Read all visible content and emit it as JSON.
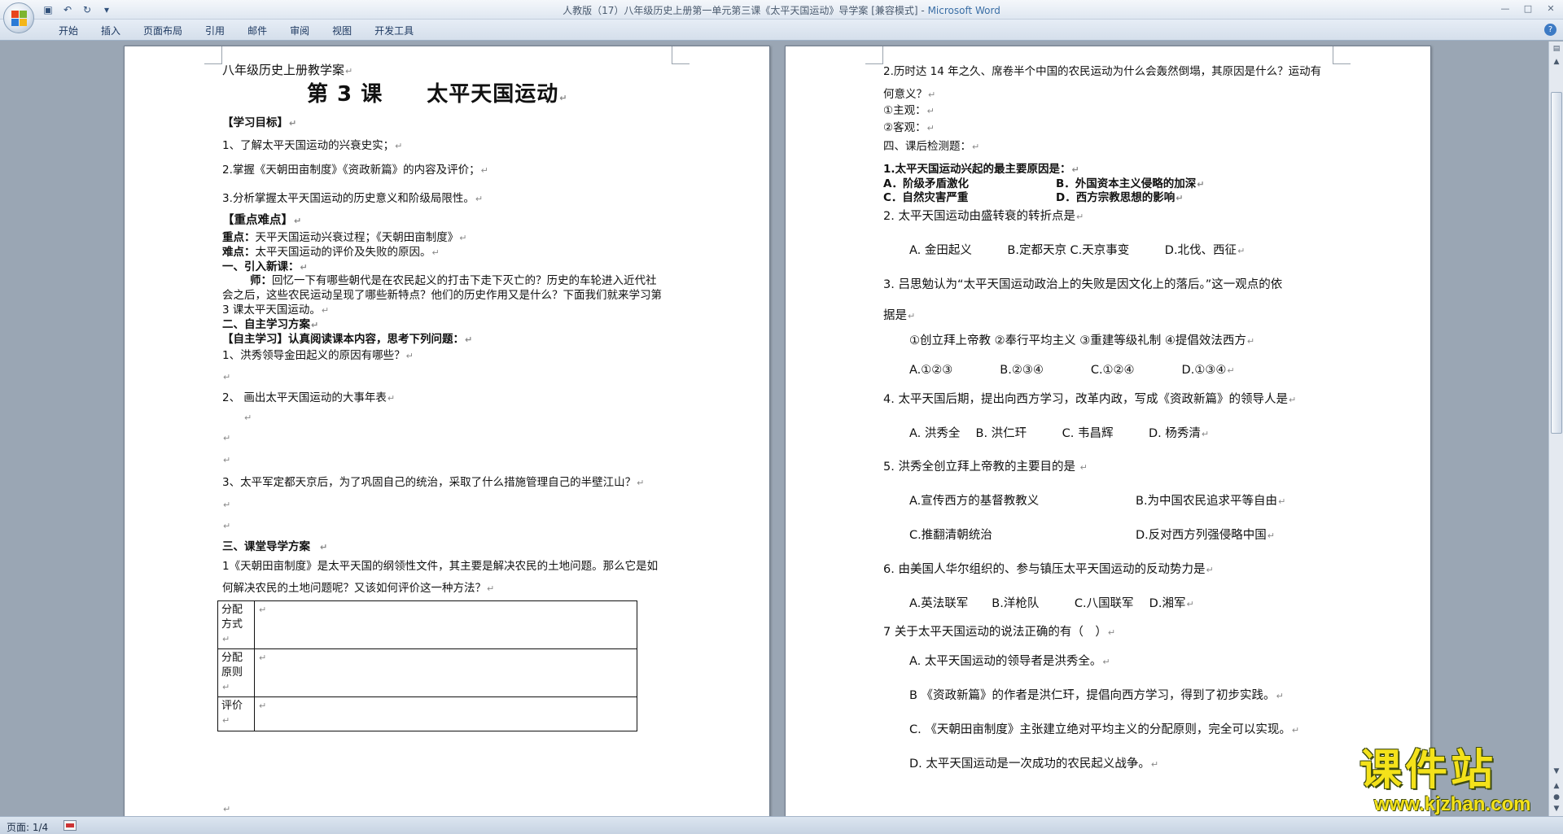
{
  "window": {
    "title": "人教版（17）八年级历史上册第一单元第三课《太平天国运动》导学案 [兼容模式] - ",
    "app_name": "Microsoft Word"
  },
  "colors": {
    "ribbon": "#dfe7f1",
    "workspace": "#9aa6b4",
    "watermark": "#f4e21a"
  },
  "qat": {
    "save_icon": "save-icon",
    "undo_icon": "undo-icon",
    "redo_icon": "redo-icon",
    "customize_icon": "customize-qat-icon"
  },
  "ribbon": {
    "tabs": [
      "开始",
      "插入",
      "页面布局",
      "引用",
      "邮件",
      "审阅",
      "视图",
      "开发工具"
    ]
  },
  "status": {
    "page": "页面: 1/4"
  },
  "watermark": {
    "cn": "课件站",
    "url": "www.kjzhan.com"
  },
  "left_page": {
    "header": "八年级历史上册教学案",
    "lesson_title": "第 3 课　　太平天国运动",
    "goals_heading": "【学习目标】",
    "goal1": "1、了解太平天国运动的兴衰史实；",
    "goal2": "2.掌握《天朝田亩制度》《资政新篇》的内容及评价；",
    "goal3": "3.分析掌握太平天国运动的历史意义和阶级局限性。",
    "key_heading": "【重点难点】",
    "key_label": "重点：",
    "key_text": "天平天国运动兴衰过程；《天朝田亩制度》",
    "difficulty_label": "难点：",
    "difficulty_text": "太平天国运动的评价及失败的原因。",
    "intro_heading": "一、引入新课：",
    "teacher_label": "师：",
    "teacher_line1": "回忆一下有哪些朝代是在农民起义的打击下走下灭亡的？历史的车轮进入近代社",
    "teacher_line2": "会之后，这些农民运动呈现了哪些新特点？他们的历史作用又是什么？下面我们就来学习第",
    "teacher_line3": "3 课太平天国运动。",
    "self_heading": "二、自主学习方案",
    "self_sub_bracket": "【自主学习】",
    "self_sub_text": "认真阅读课本内容，思考下列问题：",
    "q1": "1、洪秀领导金田起义的原因有哪些？",
    "q2": "2、 画出太平天国运动的大事年表",
    "q3": "3、太平军定都天京后，为了巩固自己的统治，采取了什么措施管理自己的半壁江山？",
    "class_heading": "三、课堂导学方案",
    "class_line1": "1《天朝田亩制度》是太平天国的纲领性文件，其主要是解决农民的土地问题。那么它是如",
    "class_line2": "何解决农民的土地问题呢？又该如何评价这一种方法？",
    "table": {
      "row1": "分配方式",
      "row2": "分配原则",
      "row3": "评价"
    }
  },
  "right_page": {
    "q2_line1": "2.历时达 14 年之久、席卷半个中国的农民运动为什么会轰然倒塌，其原因是什么？运动有",
    "q2_line2": "何意义？",
    "subjective": "①主观：",
    "objective": "②客观：",
    "test_heading": "四、课后检测题：",
    "t1": "1.太平天国运动兴起的最主要原因是：",
    "t1_a": "A．阶级矛盾激化",
    "t1_b": "B．外国资本主义侵略的加深",
    "t1_c": "C．自然灾害严重",
    "t1_d": "D．西方宗教思想的影响",
    "t2": "2. 太平天国运动由盛转衰的转折点是",
    "t2_opts": "A. 金田起义　　　B.定都天京  C.天京事变　　　D.北伐、西征",
    "t3_line1": "3. 吕思勉认为“太平天国运动政治上的失败是因文化上的落后。”这一观点的依",
    "t3_line2": "据是",
    "t3_items": "①创立拜上帝教 ②奉行平均主义 ③重建等级礼制 ④提倡效法西方",
    "t3_opts": "A.①②③　　　　B.②③④　　　　C.①②④　　　　D.①③④",
    "t4": "4. 太平天国后期，提出向西方学习，改革内政，写成《资政新篇》的领导人是",
    "t4_opts": "A. 洪秀全　 B. 洪仁玕　　　C. 韦昌辉　　　D. 杨秀清",
    "t5": "5. 洪秀全创立拜上帝教的主要目的是 ",
    "t5_a": "A.宣传西方的基督教教义",
    "t5_b": "B.为中国农民追求平等自由",
    "t5_c": "C.推翻清朝统治",
    "t5_d": "D.反对西方列强侵略中国",
    "t6": "6. 由美国人华尔组织的、参与镇压太平天国运动的反动势力是",
    "t6_opts": "A.英法联军　　B.洋枪队　　　C.八国联军　 D.湘军",
    "t7": "7 关于太平天国运动的说法正确的有（　）",
    "t7_a": "A. 太平天国运动的领导者是洪秀全。",
    "t7_b": "B 《资政新篇》的作者是洪仁玕，提倡向西方学习，得到了初步实践。",
    "t7_c": "C. 《天朝田亩制度》主张建立绝对平均主义的分配原则，完全可以实现。",
    "t7_d": "D. 太平天国运动是一次成功的农民起义战争。"
  }
}
